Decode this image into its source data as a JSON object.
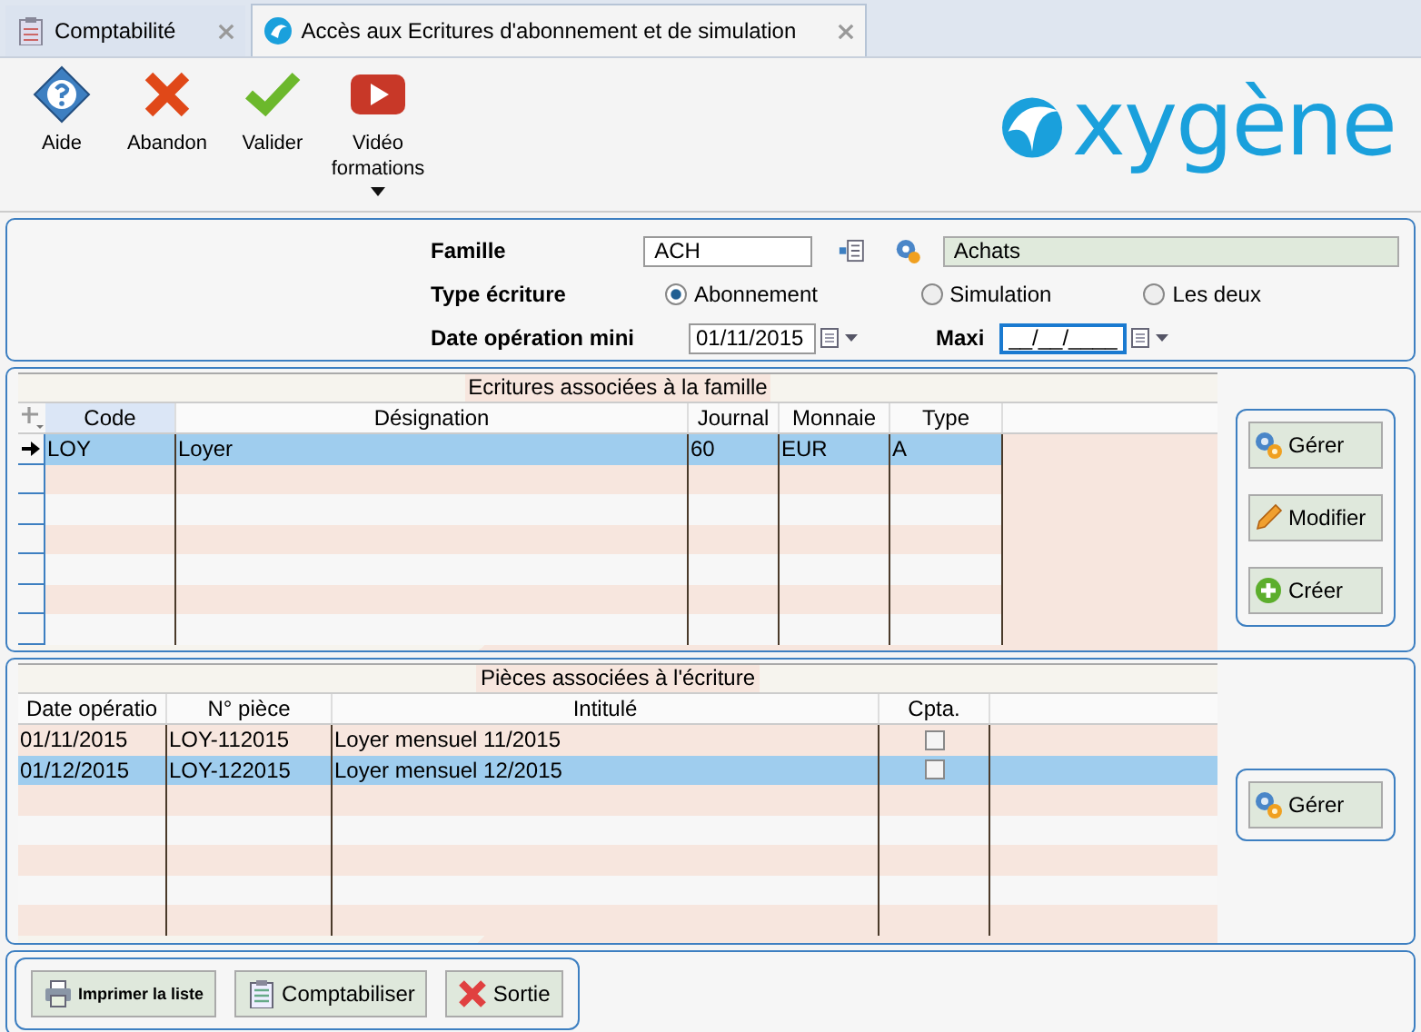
{
  "tabs": [
    {
      "label": "Comptabilité",
      "kind": "ledger",
      "selected": false
    },
    {
      "label": "Accès aux Ecritures d'abonnement et de simulation",
      "kind": "palm",
      "selected": true
    }
  ],
  "toolbar": [
    {
      "label": "Aide",
      "kind": "help",
      "dropdown": false
    },
    {
      "label": "Abandon",
      "kind": "cancel",
      "dropdown": false
    },
    {
      "label": "Valider",
      "kind": "validate",
      "dropdown": false
    },
    {
      "label": "Vidéo formations",
      "kind": "video",
      "dropdown": true
    }
  ],
  "logo": {
    "text": "xygène"
  },
  "filter": {
    "famille_label": "Famille",
    "famille_code": "ACH",
    "famille_name": "Achats",
    "type_label": "Type écriture",
    "type_options": [
      {
        "label": "Abonnement",
        "selected": true
      },
      {
        "label": "Simulation",
        "selected": false
      },
      {
        "label": "Les deux",
        "selected": false
      }
    ],
    "date_label": "Date opération mini",
    "date_min": "01/11/2015",
    "maxi_label": "Maxi",
    "date_max": "__/__/____"
  },
  "entries": {
    "title": "Ecritures associées à la famille",
    "columns": [
      "Code",
      "Désignation",
      "Journal",
      "Monnaie",
      "Type"
    ],
    "rows": [
      {
        "cells": [
          "LOY",
          "Loyer",
          "60",
          "EUR",
          "A"
        ],
        "selected": true
      }
    ],
    "buttons": [
      {
        "label": "Gérer",
        "kind": "gears"
      },
      {
        "label": "Modifier",
        "kind": "pencil"
      },
      {
        "label": "Créer",
        "kind": "plus"
      }
    ]
  },
  "pieces": {
    "title": "Pièces associées à l'écriture",
    "columns": [
      "Date opératio",
      "N° pièce",
      "Intitulé",
      "Cpta."
    ],
    "rows": [
      {
        "cells": [
          "01/11/2015",
          "LOY-112015",
          "Loyer mensuel 11/2015"
        ],
        "checked": false,
        "selected": false
      },
      {
        "cells": [
          "01/12/2015",
          "LOY-122015",
          "Loyer mensuel 12/2015"
        ],
        "checked": false,
        "selected": true
      }
    ],
    "buttons": [
      {
        "label": "Gérer",
        "kind": "gears"
      }
    ]
  },
  "footer": [
    {
      "label": "Imprimer la liste",
      "kind": "print"
    },
    {
      "label": "Comptabiliser",
      "kind": "ledger"
    },
    {
      "label": "Sortie",
      "kind": "exit"
    }
  ]
}
